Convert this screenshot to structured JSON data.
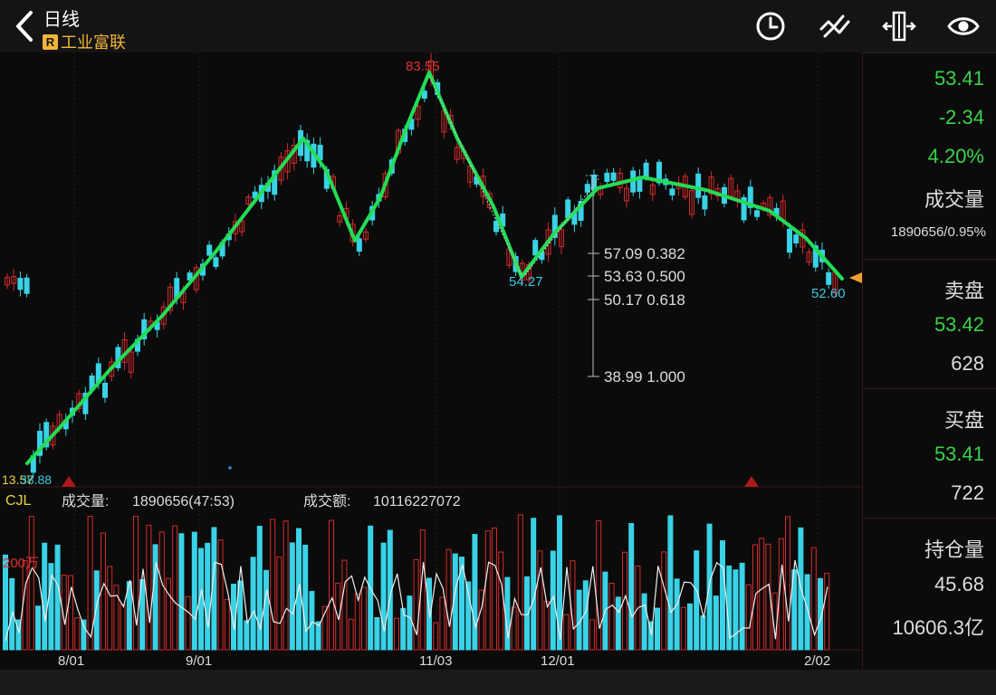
{
  "header": {
    "title": "日线",
    "stock_tag": "R",
    "stock_name": "工业富联",
    "icons": [
      "back-arrow-icon",
      "clock-icon",
      "trend-lines-icon",
      "compare-arrows-icon",
      "eye-icon"
    ]
  },
  "chart": {
    "markers": {
      "high": "83.55",
      "low_mid": "54.27",
      "last_low": "52.60",
      "start_a": "13.57",
      "start_b": "38.88"
    },
    "fib": [
      {
        "price": "57.09",
        "ratio": "0.382"
      },
      {
        "price": "53.63",
        "ratio": "0.500"
      },
      {
        "price": "50.17",
        "ratio": "0.618"
      },
      {
        "price": "38.99",
        "ratio": "1.000"
      }
    ],
    "volume": {
      "indicator": "CJL",
      "vol_label": "成交量:",
      "vol_value": "1890656(47:53)",
      "amt_label": "成交额:",
      "amt_value": "10116227072",
      "scale": "200万"
    },
    "dates": [
      "8/01",
      "9/01",
      "11/03",
      "12/01",
      "2/02"
    ],
    "colors": {
      "up": "#d42b2b",
      "down": "#39d2e6",
      "trend": "#22dd55",
      "grid": "#3a1515"
    }
  },
  "sidebar": {
    "price": "53.41",
    "change": "-2.34",
    "pct": "4.20%",
    "volume_label": "成交量",
    "volume_value": "1890656/0.95%",
    "sell_label": "卖盘",
    "sell_price": "53.42",
    "sell_qty": "628",
    "buy_label": "买盘",
    "buy_price": "53.41",
    "buy_qty": "722",
    "oi_label": "持仓量",
    "oi_value": "45.68",
    "amount_value": "10606.3亿"
  }
}
